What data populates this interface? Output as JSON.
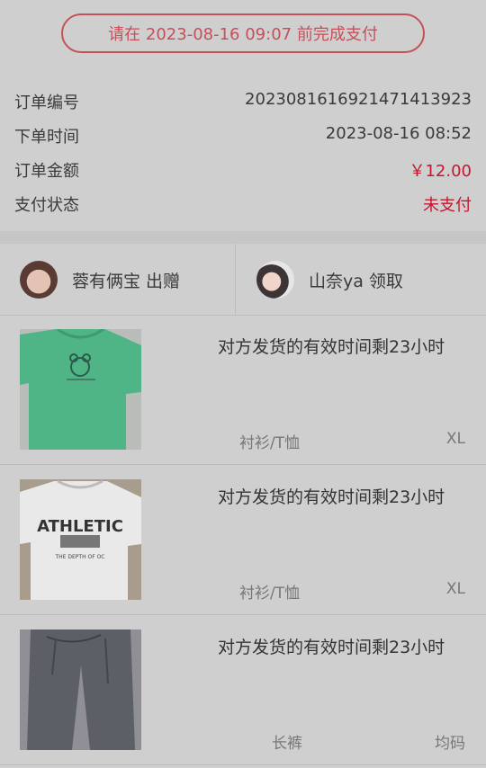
{
  "payment": {
    "deadline_text": "请在 2023-08-16 09:07 前完成支付"
  },
  "order": {
    "rows": [
      {
        "label": "订单编号",
        "value": "20230816169214714​13923"
      },
      {
        "label": "下单时间",
        "value": "2023-08-16 08:52"
      },
      {
        "label": "订单金额",
        "value": "￥12.00"
      },
      {
        "label": "支付状态",
        "value": "未支付"
      }
    ]
  },
  "users": {
    "giver": "蓉有俩宝 出赠",
    "receiver": "山奈ya 领取"
  },
  "items": [
    {
      "title": "对方发货的有效时间剩23小时",
      "category": "衬衫/T恤",
      "size": "XL"
    },
    {
      "title": "对方发货的有效时间剩23小时",
      "category": "衬衫/T恤",
      "size": "XL"
    },
    {
      "title": "对方发货的有效时间剩23小时",
      "category": "长裤",
      "size": "均码"
    }
  ],
  "colors": {
    "accent": "#c4162e",
    "button_border": "#c4505a"
  }
}
